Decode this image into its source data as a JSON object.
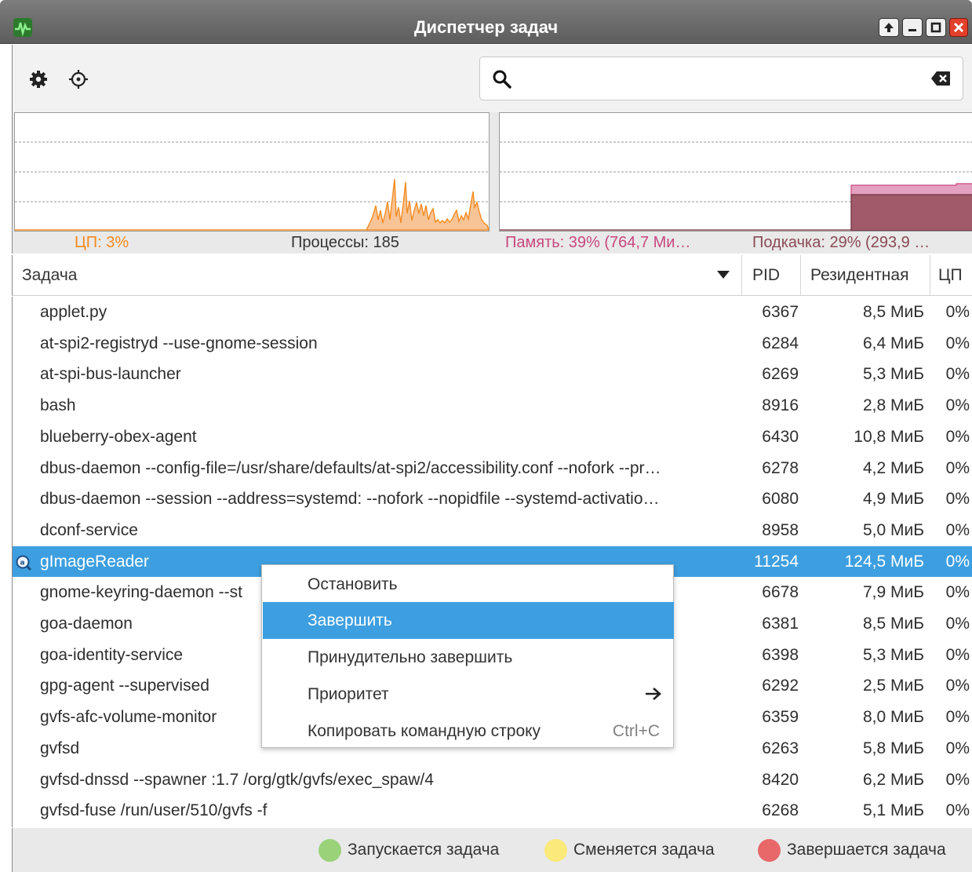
{
  "window": {
    "title": "Диспетчер задач"
  },
  "toolbar": {
    "search": {
      "value": "",
      "placeholder": ""
    }
  },
  "graphs": {
    "cpu_label": "ЦП: 3%",
    "processes_label": "Процессы: 185",
    "memory_label": "Память: 39% (764,7 Ми…",
    "swap_label": "Подкачка: 29% (293,9 …",
    "colors": {
      "cpu": "#f58a1f",
      "memory": "#c8487e",
      "swap": "#8a4a55"
    }
  },
  "table": {
    "columns": [
      "Задача",
      "PID",
      "Резидентная",
      "ЦП"
    ],
    "rows": [
      {
        "task": "applet.py",
        "pid": "6367",
        "res": "8,5 МиБ",
        "cpu": "0%"
      },
      {
        "task": "at-spi2-registryd --use-gnome-session",
        "pid": "6284",
        "res": "6,4 МиБ",
        "cpu": "0%"
      },
      {
        "task": "at-spi-bus-launcher",
        "pid": "6269",
        "res": "5,3 МиБ",
        "cpu": "0%"
      },
      {
        "task": "bash",
        "pid": "8916",
        "res": "2,8 МиБ",
        "cpu": "0%"
      },
      {
        "task": "blueberry-obex-agent",
        "pid": "6430",
        "res": "10,8 МиБ",
        "cpu": "0%"
      },
      {
        "task": "dbus-daemon --config-file=/usr/share/defaults/at-spi2/accessibility.conf --nofork --pr…",
        "pid": "6278",
        "res": "4,2 МиБ",
        "cpu": "0%"
      },
      {
        "task": "dbus-daemon --session --address=systemd: --nofork --nopidfile --systemd-activatio…",
        "pid": "6080",
        "res": "4,9 МиБ",
        "cpu": "0%"
      },
      {
        "task": "dconf-service",
        "pid": "8958",
        "res": "5,0 МиБ",
        "cpu": "0%"
      },
      {
        "task": "gImageReader",
        "pid": "11254",
        "res": "124,5 МиБ",
        "cpu": "0%",
        "selected": true
      },
      {
        "task": "gnome-keyring-daemon --st",
        "pid": "6678",
        "res": "7,9 МиБ",
        "cpu": "0%"
      },
      {
        "task": "goa-daemon",
        "pid": "6381",
        "res": "8,5 МиБ",
        "cpu": "0%"
      },
      {
        "task": "goa-identity-service",
        "pid": "6398",
        "res": "5,3 МиБ",
        "cpu": "0%"
      },
      {
        "task": "gpg-agent --supervised",
        "pid": "6292",
        "res": "2,5 МиБ",
        "cpu": "0%"
      },
      {
        "task": "gvfs-afc-volume-monitor",
        "pid": "6359",
        "res": "8,0 МиБ",
        "cpu": "0%"
      },
      {
        "task": "gvfsd",
        "pid": "6263",
        "res": "5,8 МиБ",
        "cpu": "0%"
      },
      {
        "task": "gvfsd-dnssd --spawner :1.7 /org/gtk/gvfs/exec_spaw/4",
        "pid": "8420",
        "res": "6,2 МиБ",
        "cpu": "0%"
      },
      {
        "task": "gvfsd-fuse /run/user/510/gvfs -f",
        "pid": "6268",
        "res": "5,1 МиБ",
        "cpu": "0%"
      }
    ]
  },
  "context_menu": {
    "items": [
      {
        "label": "Остановить"
      },
      {
        "label": "Завершить",
        "active": true
      },
      {
        "label": "Принудительно завершить"
      },
      {
        "label": "Приоритет",
        "submenu": true
      },
      {
        "label": "Копировать командную строку",
        "shortcut": "Ctrl+C"
      }
    ]
  },
  "statusbar": {
    "legend": [
      {
        "label": "Запускается задача",
        "color": "#9ad27a"
      },
      {
        "label": "Сменяется задача",
        "color": "#fbe97a"
      },
      {
        "label": "Завершается задача",
        "color": "#e8686a"
      }
    ]
  }
}
